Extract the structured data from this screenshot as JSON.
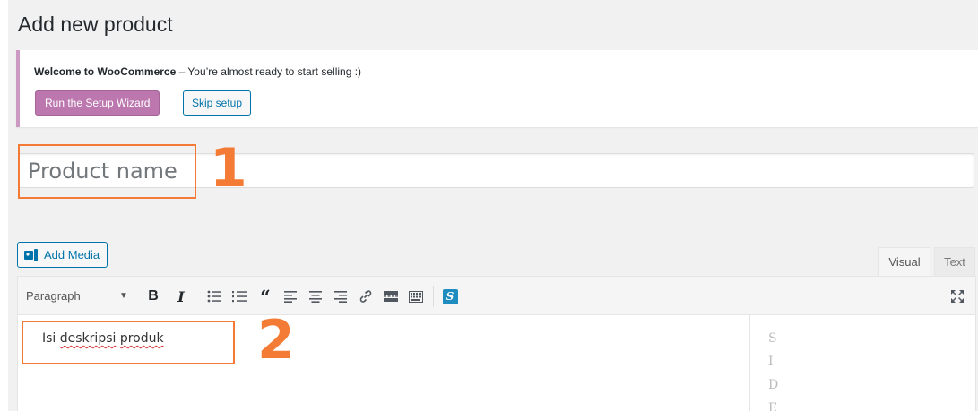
{
  "page": {
    "title": "Add new product"
  },
  "notice": {
    "brand": "Welcome to WooCommerce",
    "message": " – You’re almost ready to start selling :)",
    "wizard_button": "Run the Setup Wizard",
    "skip_button": "Skip setup"
  },
  "title_field": {
    "placeholder": "Product name",
    "value": ""
  },
  "annotations": {
    "label_1": "1",
    "label_2": "2",
    "color": "#f47b35"
  },
  "editor": {
    "add_media": "Add Media",
    "tabs": [
      {
        "label": "Visual"
      },
      {
        "label": "Text"
      }
    ],
    "format_select": "Paragraph",
    "content": {
      "word1": "Isi",
      "word2": "deskripsi",
      "word3": "produk"
    },
    "side_letters": [
      "S",
      "I",
      "D",
      "E"
    ]
  },
  "colors": {
    "woo_purple": "#bb77ae",
    "wp_blue": "#0073aa",
    "notice_border": "#cc99c2"
  }
}
